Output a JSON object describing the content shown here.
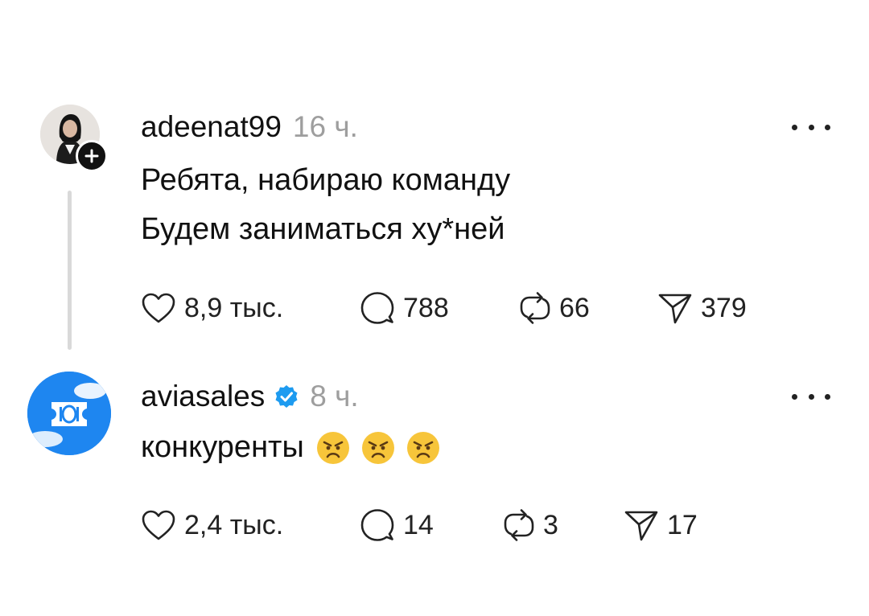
{
  "posts": [
    {
      "username": "adeenat99",
      "time": "16 ч.",
      "text": "Ребята, набираю команду\nБудем заниматься ху*ней",
      "likes": "8,9 тыс.",
      "comments": "788",
      "reposts": "66",
      "shares": "379",
      "avatar_icon": "profile-photo",
      "has_follow_badge": true,
      "verified": false
    },
    {
      "username": "aviasales",
      "time": "8 ч.",
      "text": "конкуренты",
      "emojis": [
        "angry-face",
        "angry-face",
        "angry-face"
      ],
      "likes": "2,4 тыс.",
      "comments": "14",
      "reposts": "3",
      "shares": "17",
      "avatar_icon": "ticket-logo",
      "has_follow_badge": false,
      "verified": true
    }
  ],
  "colors": {
    "text": "#111111",
    "muted": "#9e9e9e",
    "verified": "#1d9bf0",
    "aviasales_brand": "#1e86f0",
    "emoji": "#f7c53a"
  }
}
